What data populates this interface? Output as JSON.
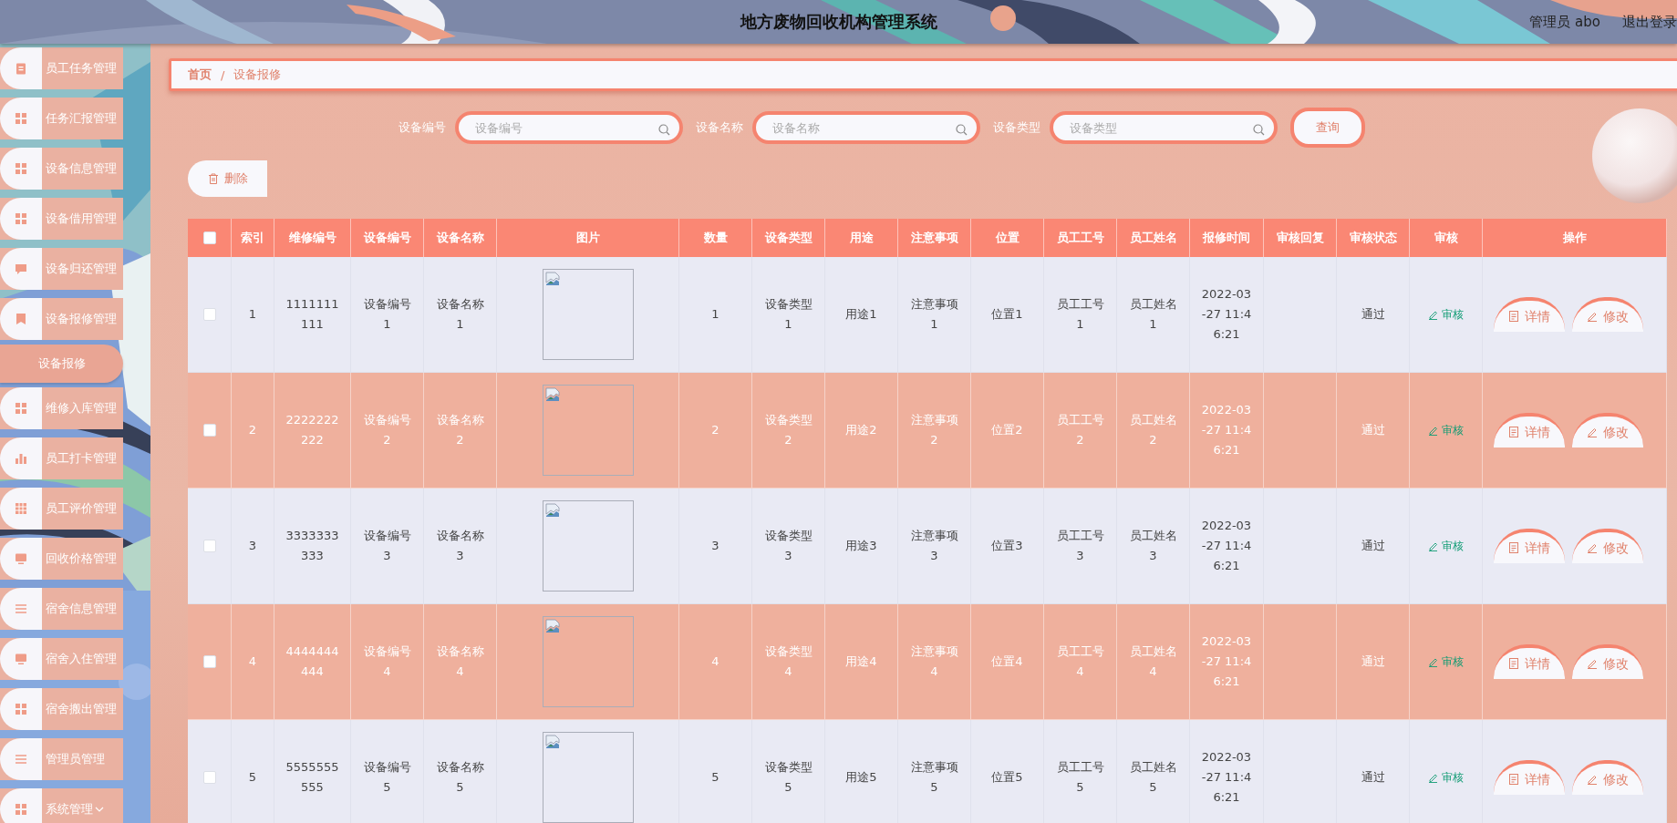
{
  "header": {
    "title": "地方废物回收机构管理系统",
    "user": "管理员 abo",
    "logout": "退出登录"
  },
  "sidebar": {
    "items": [
      {
        "label": "员工任务管理"
      },
      {
        "label": "任务汇报管理"
      },
      {
        "label": "设备信息管理"
      },
      {
        "label": "设备借用管理"
      },
      {
        "label": "设备归还管理"
      },
      {
        "label": "设备报修管理",
        "expanded": true,
        "children": [
          {
            "label": "设备报修",
            "selected": true
          }
        ]
      },
      {
        "label": "维修入库管理"
      },
      {
        "label": "员工打卡管理"
      },
      {
        "label": "员工评价管理"
      },
      {
        "label": "回收价格管理"
      },
      {
        "label": "宿舍信息管理"
      },
      {
        "label": "宿舍入住管理"
      },
      {
        "label": "宿舍搬出管理"
      },
      {
        "label": "管理员管理"
      },
      {
        "label": "系统管理",
        "expanded": false
      }
    ]
  },
  "breadcrumb": {
    "items": [
      "首页",
      "设备报修"
    ],
    "separator": "/"
  },
  "search": {
    "fields": [
      {
        "label": "设备编号",
        "placeholder": "设备编号"
      },
      {
        "label": "设备名称",
        "placeholder": "设备名称"
      },
      {
        "label": "设备类型",
        "placeholder": "设备类型"
      }
    ],
    "button": "查询"
  },
  "toolbar": {
    "delete": "删除"
  },
  "table": {
    "select_all_checked": false,
    "columns": [
      "索引",
      "维修编号",
      "设备编号",
      "设备名称",
      "图片",
      "数量",
      "设备类型",
      "用途",
      "注意事项",
      "位置",
      "员工工号",
      "员工姓名",
      "报修时间",
      "审核回复",
      "审核状态",
      "审核",
      "操作"
    ],
    "rows": [
      {
        "checked": false,
        "index": "1",
        "repair_no": "1111111111",
        "device_no": "设备编号1",
        "device_name": "设备名称1",
        "quantity": "1",
        "device_type": "设备类型1",
        "usage": "用途1",
        "notes": "注意事项1",
        "location": "位置1",
        "emp_no": "员工工号1",
        "emp_name": "员工姓名1",
        "time": "2022-03-27 11:46:21",
        "status": "通过",
        "audit": "审核",
        "actions": [
          "详情",
          "修改"
        ]
      },
      {
        "checked": false,
        "index": "2",
        "repair_no": "2222222222",
        "device_no": "设备编号2",
        "device_name": "设备名称2",
        "quantity": "2",
        "device_type": "设备类型2",
        "usage": "用途2",
        "notes": "注意事项2",
        "location": "位置2",
        "emp_no": "员工工号2",
        "emp_name": "员工姓名2",
        "time": "2022-03-27 11:46:21",
        "status": "通过",
        "audit": "审核",
        "actions": [
          "详情",
          "修改"
        ]
      },
      {
        "checked": false,
        "index": "3",
        "repair_no": "3333333333",
        "device_no": "设备编号3",
        "device_name": "设备名称3",
        "quantity": "3",
        "device_type": "设备类型3",
        "usage": "用途3",
        "notes": "注意事项3",
        "location": "位置3",
        "emp_no": "员工工号3",
        "emp_name": "员工姓名3",
        "time": "2022-03-27 11:46:21",
        "status": "通过",
        "audit": "审核",
        "actions": [
          "详情",
          "修改"
        ]
      },
      {
        "checked": false,
        "index": "4",
        "repair_no": "4444444444",
        "device_no": "设备编号4",
        "device_name": "设备名称4",
        "quantity": "4",
        "device_type": "设备类型4",
        "usage": "用途4",
        "notes": "注意事项4",
        "location": "位置4",
        "emp_no": "员工工号4",
        "emp_name": "员工姓名4",
        "time": "2022-03-27 11:46:21",
        "status": "通过",
        "audit": "审核",
        "actions": [
          "详情",
          "修改"
        ]
      },
      {
        "checked": false,
        "index": "5",
        "repair_no": "5555555555",
        "device_no": "设备编号5",
        "device_name": "设备名称5",
        "quantity": "5",
        "device_type": "设备类型5",
        "usage": "用途5",
        "notes": "注意事项5",
        "location": "位置5",
        "emp_no": "员工工号5",
        "emp_name": "员工姓名5",
        "time": "2022-03-27 11:46:21",
        "status": "通过",
        "audit": "审核",
        "actions": [
          "详情",
          "修改"
        ]
      }
    ]
  }
}
